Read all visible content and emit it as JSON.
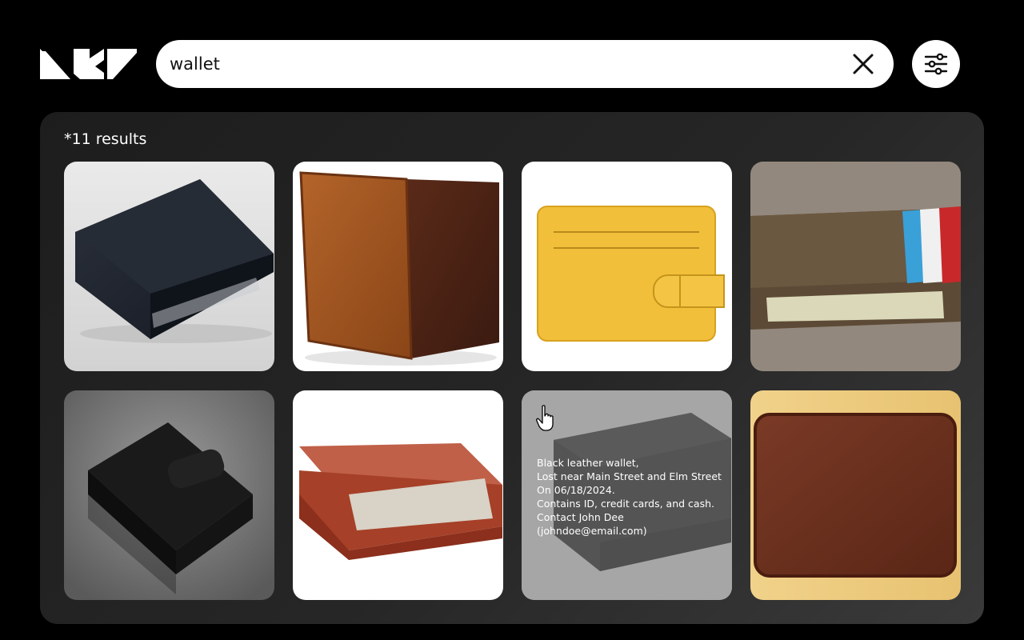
{
  "header": {
    "logo_icon": "lrv-logo-icon",
    "search": {
      "value": "wallet",
      "placeholder": ""
    },
    "clear_icon": "close-icon",
    "filter_icon": "sliders-icon"
  },
  "results": {
    "count_label": "*11 results",
    "cards": [
      {
        "index": 1,
        "image": "black-bifold-wallet"
      },
      {
        "index": 2,
        "image": "tan-brown-bifold-wallet"
      },
      {
        "index": 3,
        "image": "yellow-card-wallet"
      },
      {
        "index": 4,
        "image": "worn-brown-wallet-with-cash"
      },
      {
        "index": 5,
        "image": "black-croc-wallet"
      },
      {
        "index": 6,
        "image": "red-brown-wallet-with-euros"
      },
      {
        "index": 7,
        "image": "black-leather-wallet",
        "hovered": true,
        "details": {
          "line1": "Black leather wallet,",
          "line2": "Lost near Main Street and Elm Street",
          "line3": "On 06/18/2024.",
          "line4": "Contains ID, credit cards, and cash.",
          "line5": "Contact John Dee (johndoe@email.com)"
        }
      },
      {
        "index": 8,
        "image": "brown-leather-bifold-wallet"
      }
    ]
  },
  "cursor": "hand-pointer-icon",
  "colors": {
    "background": "#000000",
    "panel": "#262626",
    "search_bg": "#ffffff",
    "text": "#ffffff"
  }
}
